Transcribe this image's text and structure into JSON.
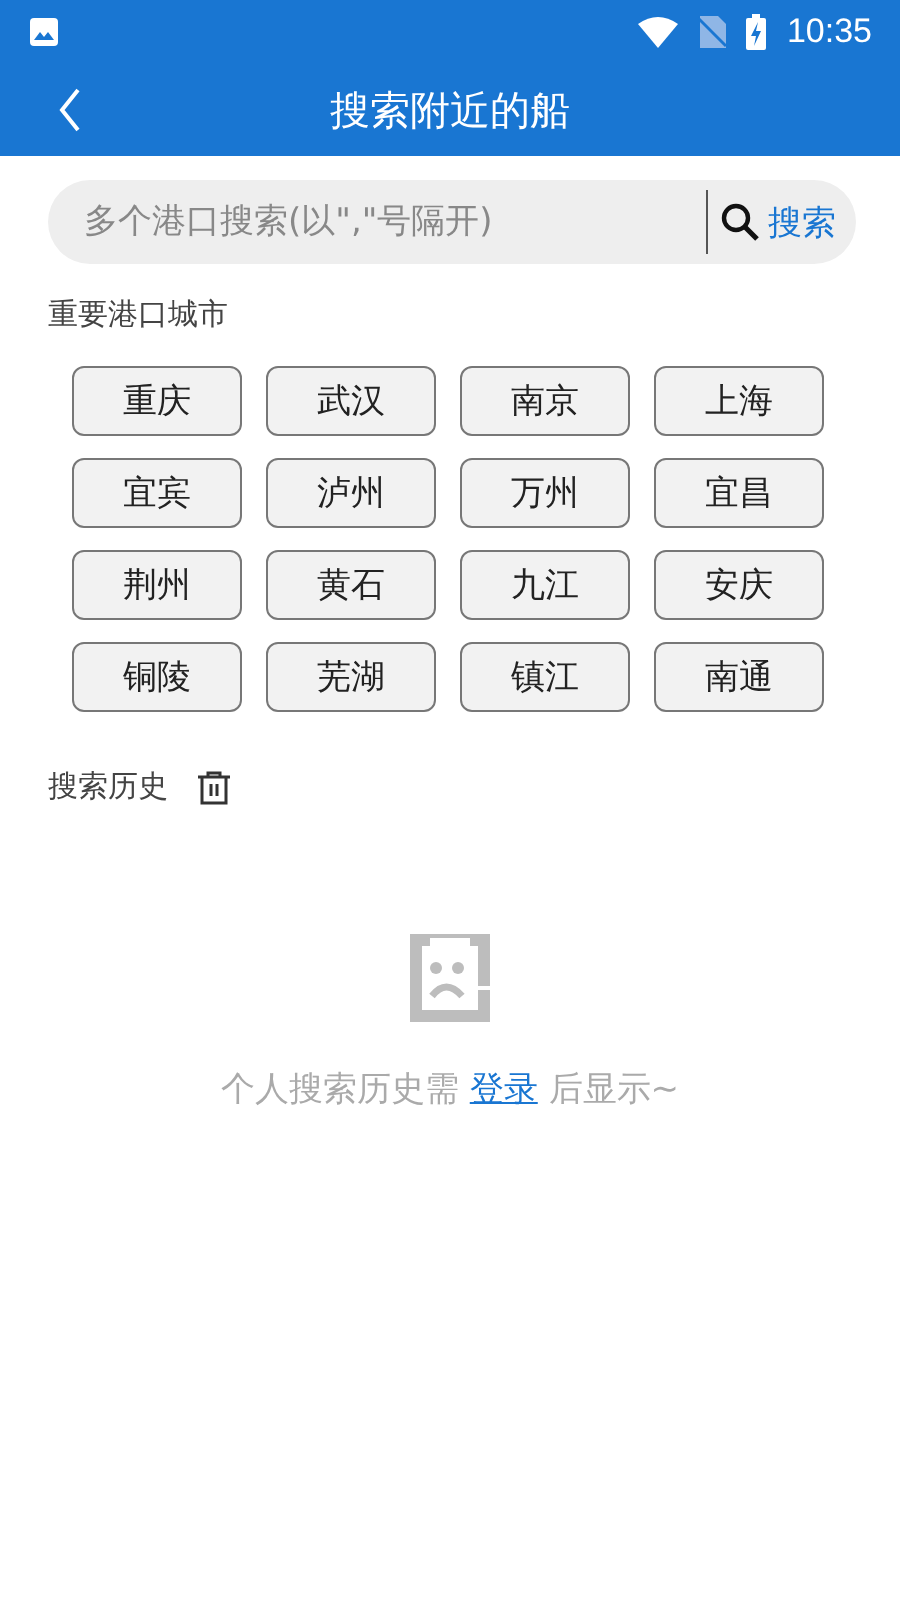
{
  "status_bar": {
    "time": "10:35"
  },
  "app_bar": {
    "title": "搜索附近的船"
  },
  "search": {
    "placeholder": "多个港口搜索(以\",\"号隔开)",
    "button": "搜索"
  },
  "ports": {
    "title": "重要港口城市",
    "items": [
      {
        "label": "重庆"
      },
      {
        "label": "武汉"
      },
      {
        "label": "南京"
      },
      {
        "label": "上海"
      },
      {
        "label": "宜宾"
      },
      {
        "label": "泸州"
      },
      {
        "label": "万州"
      },
      {
        "label": "宜昌"
      },
      {
        "label": "荆州"
      },
      {
        "label": "黄石"
      },
      {
        "label": "九江"
      },
      {
        "label": "安庆"
      },
      {
        "label": "铜陵"
      },
      {
        "label": "芜湖"
      },
      {
        "label": "镇江"
      },
      {
        "label": "南通"
      }
    ]
  },
  "history": {
    "title": "搜索历史"
  },
  "empty_state": {
    "before": "个人搜索历史需",
    "link": "登录",
    "after": "后显示~"
  }
}
